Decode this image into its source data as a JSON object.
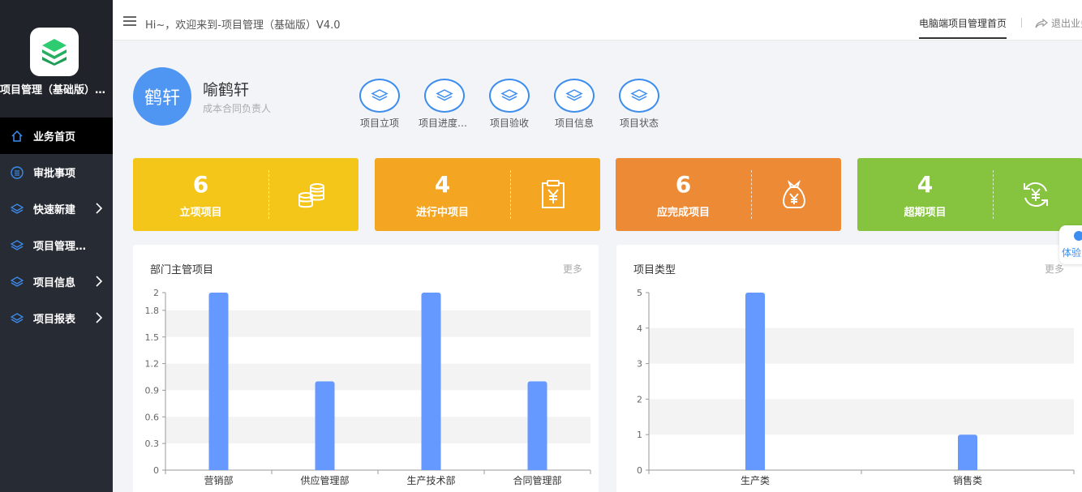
{
  "app": {
    "name": "项目管理（基础版）V4.0"
  },
  "sidebar": {
    "items": [
      {
        "label": "业务首页",
        "icon": "home-icon",
        "active": true,
        "has_children": false
      },
      {
        "label": "审批事项",
        "icon": "list-icon",
        "active": false,
        "has_children": false
      },
      {
        "label": "快速新建",
        "icon": "layers-icon",
        "active": false,
        "has_children": true
      },
      {
        "label": "项目管理流程",
        "icon": "layers-icon",
        "active": false,
        "has_children": false
      },
      {
        "label": "项目信息",
        "icon": "layers-icon",
        "active": false,
        "has_children": true
      },
      {
        "label": "项目报表",
        "icon": "layers-icon",
        "active": false,
        "has_children": true
      }
    ]
  },
  "header": {
    "welcome": "Hi~，欢迎来到-项目管理（基础版）V4.0",
    "active_tab": "电脑端项目管理首页",
    "logout": "退出业务"
  },
  "profile": {
    "avatar_text": "鹤轩",
    "name": "喻鹤轩",
    "role": "成本合同负责人"
  },
  "quick_links": [
    {
      "label": "项目立项"
    },
    {
      "label": "项目进度跟踪"
    },
    {
      "label": "项目验收"
    },
    {
      "label": "项目信息"
    },
    {
      "label": "项目状态"
    }
  ],
  "stats": [
    {
      "value": "6",
      "label": "立项项目",
      "color": "#f4c61a",
      "icon": "coins-icon"
    },
    {
      "value": "4",
      "label": "进行中项目",
      "color": "#f4a623",
      "icon": "clipboard-yen-icon"
    },
    {
      "value": "6",
      "label": "应完成项目",
      "color": "#ec8a35",
      "icon": "money-bag-icon"
    },
    {
      "value": "4",
      "label": "超期项目",
      "color": "#86c43f",
      "icon": "refresh-yen-icon"
    }
  ],
  "panels": {
    "left": {
      "title": "部门主管项目",
      "more": "更多"
    },
    "right": {
      "title": "项目类型",
      "more": "更多"
    }
  },
  "float_tab": {
    "label": "体验"
  },
  "colors": {
    "bar": "#6699ff",
    "accent": "#3d8df0"
  },
  "chart_data": [
    {
      "type": "bar",
      "categories": [
        "营销部",
        "供应管理部",
        "生产技术部",
        "合同管理部"
      ],
      "values": [
        2,
        1,
        2,
        1
      ],
      "ylim": [
        0,
        2
      ],
      "yticks": [
        "0",
        "0.3",
        "0.6",
        "0.9",
        "1.2",
        "1.5",
        "1.8",
        "2"
      ],
      "ytick_values": [
        0,
        0.3,
        0.6,
        0.9,
        1.2,
        1.5,
        1.8,
        2
      ],
      "grid": "banded"
    },
    {
      "type": "bar",
      "categories": [
        "生产类",
        "销售类"
      ],
      "values": [
        5,
        1
      ],
      "ylim": [
        0,
        5
      ],
      "yticks": [
        "0",
        "1",
        "2",
        "3",
        "4",
        "5"
      ],
      "ytick_values": [
        0,
        1,
        2,
        3,
        4,
        5
      ],
      "grid": "banded"
    }
  ]
}
